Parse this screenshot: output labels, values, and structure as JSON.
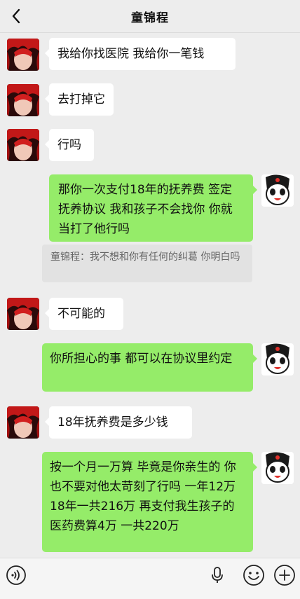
{
  "header": {
    "title": "童锦程"
  },
  "messages": [
    {
      "side": "in",
      "text": "我给你找医院 我给你一笔钱"
    },
    {
      "side": "in",
      "text": "去打掉它"
    },
    {
      "side": "in",
      "text": "行吗"
    },
    {
      "side": "out",
      "text": "那你一次支付18年的抚养费 签定抚养协议 我和孩子不会找你 你就当打了他行吗"
    },
    {
      "side": "in",
      "text": "不可能的"
    },
    {
      "side": "out",
      "text": "你所担心的事 都可以在协议里约定"
    },
    {
      "side": "in",
      "text": "18年抚养费是多少钱"
    },
    {
      "side": "out",
      "text": "按一个月一万算 毕竟是你亲生的 你也不要对他太苛刻了行吗 一年12万 18年一共216万 再支付我生孩子的医药费算4万 一共220万"
    }
  ],
  "quote": {
    "text": "童锦程：我不想和你有任何的纠葛 你明白吗"
  },
  "icons": {
    "back": "chevron-left-icon",
    "voice": "voice-icon",
    "mic": "microphone-icon",
    "emoji": "emoji-icon",
    "plus": "plus-icon"
  },
  "colors": {
    "outgoing": "#95ec69",
    "incoming": "#ffffff",
    "background": "#ededed"
  }
}
